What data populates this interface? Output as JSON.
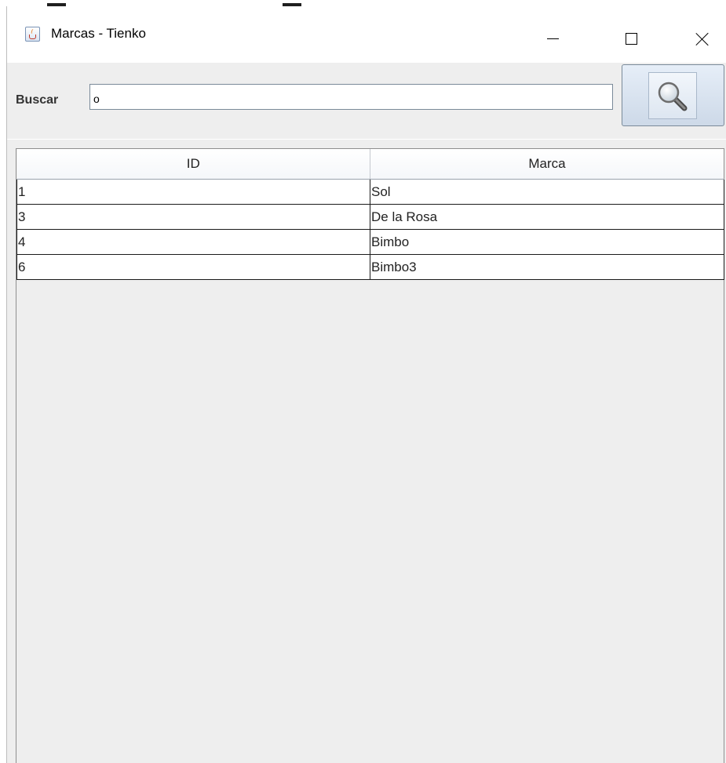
{
  "window": {
    "title": "Marcas - Tienko",
    "icon": "java-cup-icon",
    "controls": [
      "minimize",
      "maximize",
      "close"
    ]
  },
  "search": {
    "label": "Buscar",
    "value": "o",
    "button_icon": "magnifier-icon"
  },
  "table": {
    "columns": [
      "ID",
      "Marca"
    ],
    "rows": [
      {
        "id": "1",
        "marca": "Sol"
      },
      {
        "id": "3",
        "marca": "De la Rosa"
      },
      {
        "id": "4",
        "marca": "Bimbo"
      },
      {
        "id": "6",
        "marca": "Bimbo3"
      }
    ]
  }
}
